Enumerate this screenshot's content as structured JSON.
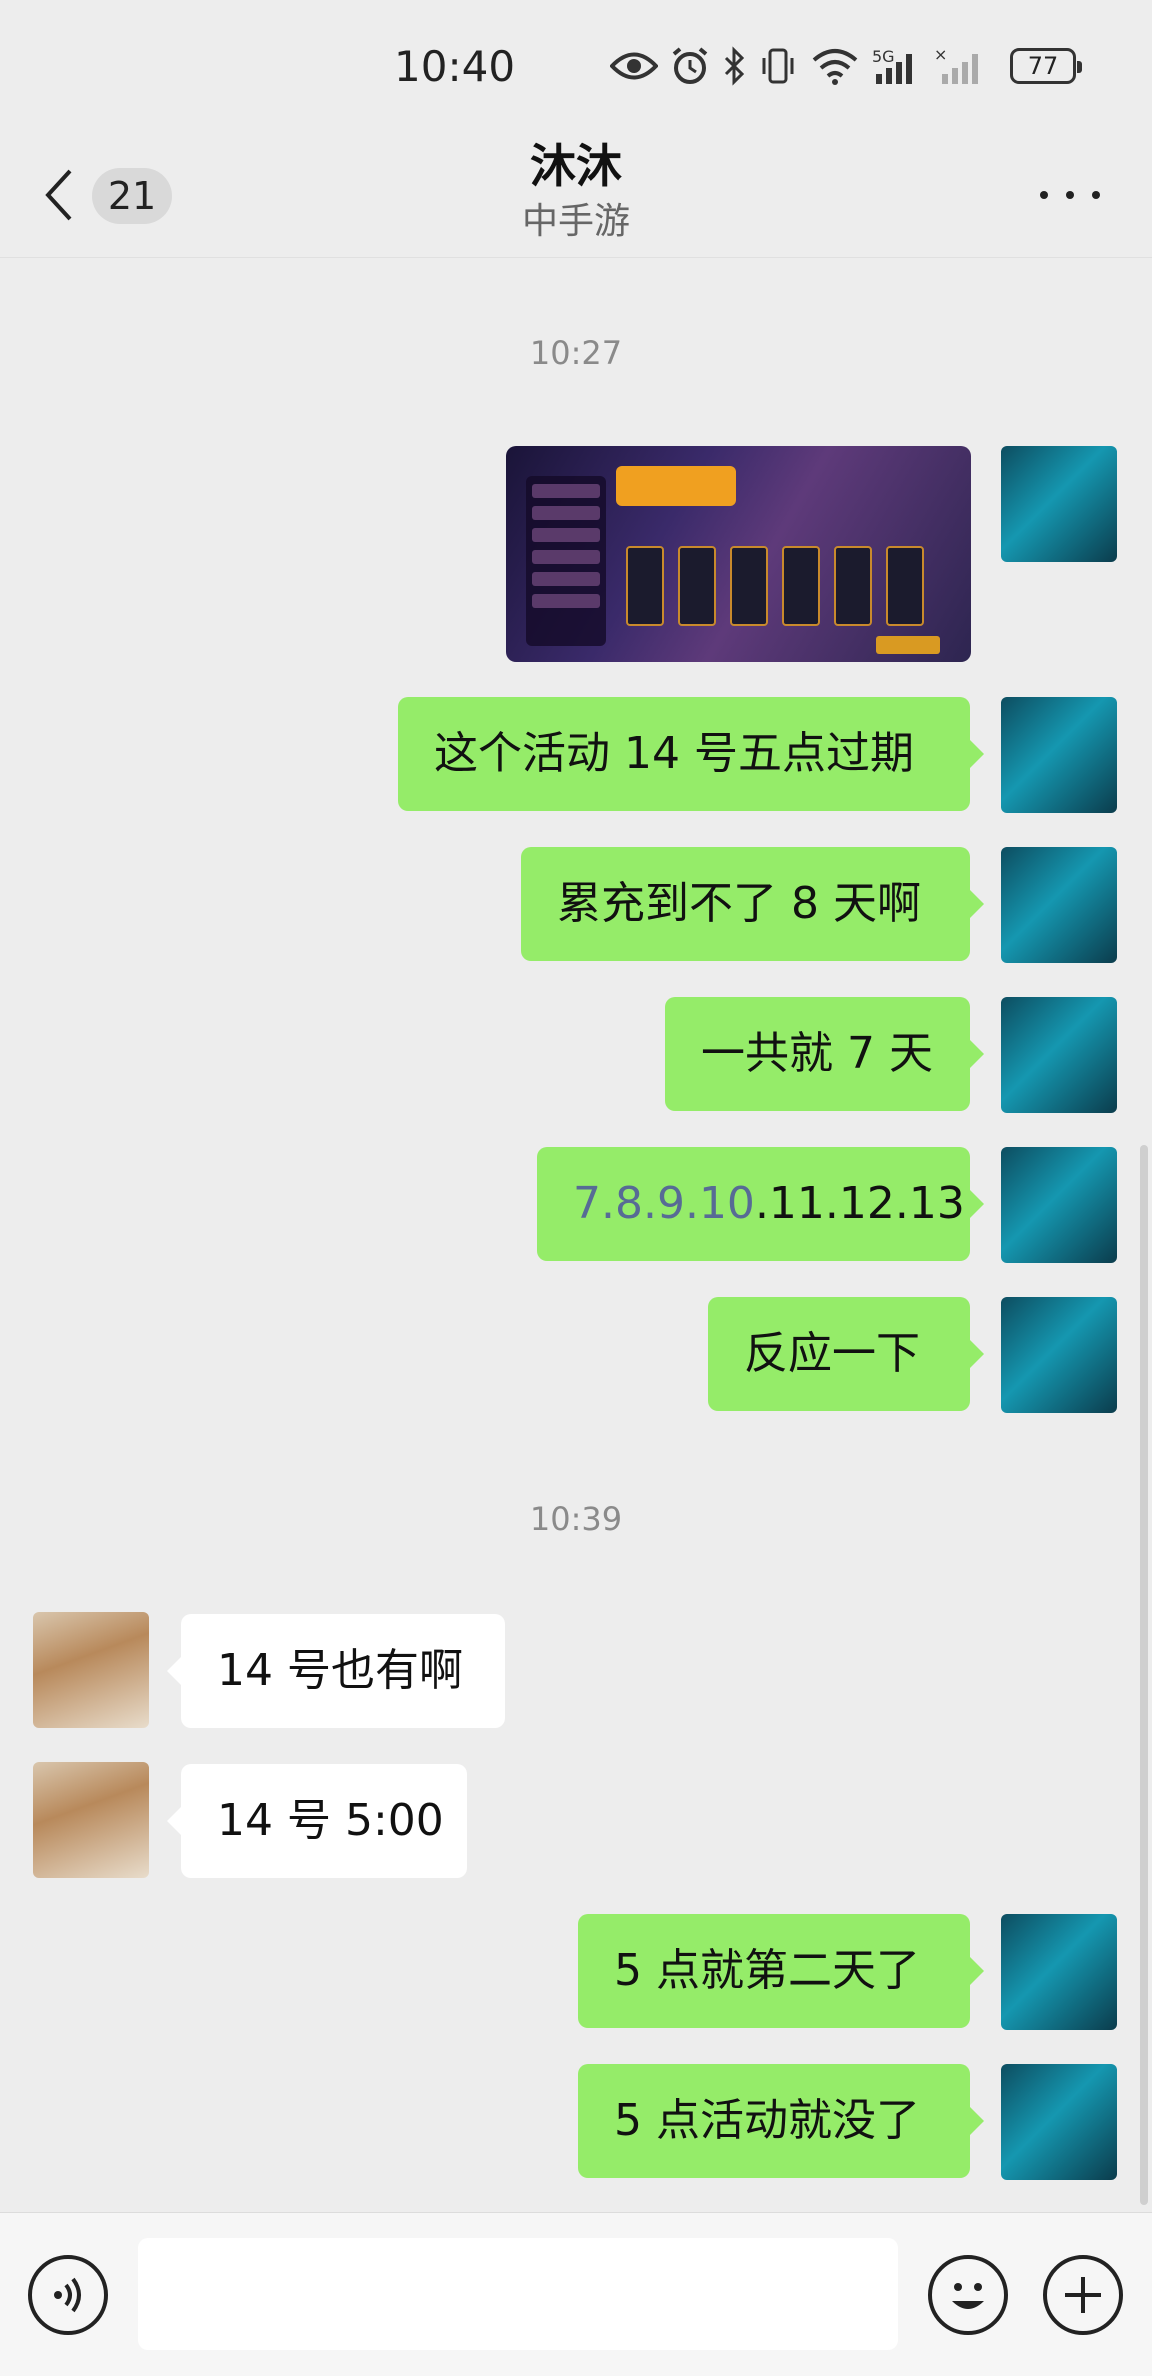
{
  "status_bar": {
    "time": "10:40",
    "battery": "77",
    "icons": [
      "eye-icon",
      "alarm-icon",
      "bluetooth-icon",
      "vibrate-icon",
      "wifi-icon",
      "signal-5g-icon",
      "signal-icon"
    ]
  },
  "header": {
    "unread_count": "21",
    "title": "沐沐",
    "subtitle": "中手游"
  },
  "messages": {
    "time1": "10:27",
    "m1": "这个活动 14 号五点过期",
    "m2": "累充到不了 8 天啊",
    "m3": "一共就 7 天",
    "m4_link": "7.8.9.10",
    "m4_rest": ".11.12.13",
    "m5": "反应一下",
    "time2": "10:39",
    "r1": "14 号也有啊",
    "r2": "14 号 5:00",
    "m6": "5 点就第二天了",
    "m7": "5 点活动就没了"
  },
  "colors": {
    "sent_bubble": "#95ec69",
    "received_bubble": "#ffffff",
    "background": "#ededed",
    "link": "#576b95"
  }
}
